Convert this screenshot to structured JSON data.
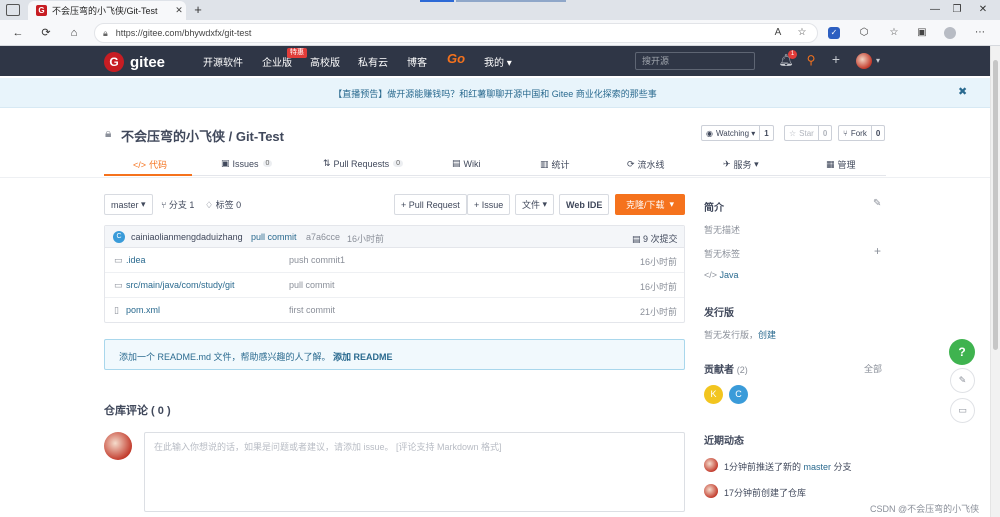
{
  "browser": {
    "tab_title": "不会压弯的小飞侠/Git-Test",
    "tab_favicon": "G",
    "url": "https://gitee.com/bhywdxfx/git-test"
  },
  "nav": {
    "brand": "gitee",
    "items": [
      "开源软件",
      "企业版",
      "高校版",
      "私有云",
      "博客",
      "Go",
      "我的"
    ],
    "enterprise_badge": "特惠",
    "search_placeholder": "搜开源",
    "notification_count": "1"
  },
  "banner": {
    "text": "【直播预告】做开源能赚钱吗？和红薯聊聊开源中国和 Gitee 商业化探索的那些事",
    "close": "✖"
  },
  "repo": {
    "title": "不会压弯的小飞侠 / Git-Test",
    "watching_label": "Watching",
    "watching_count": "1",
    "star_label": "Star",
    "star_count": "0",
    "fork_label": "Fork",
    "fork_count": "0"
  },
  "tabs": [
    {
      "label": "代码",
      "icon": "</>"
    },
    {
      "label": "Issues",
      "count": "0",
      "icon": "▣"
    },
    {
      "label": "Pull Requests",
      "count": "0",
      "icon": "⇅"
    },
    {
      "label": "Wiki",
      "icon": "▤"
    },
    {
      "label": "统计",
      "icon": "▥"
    },
    {
      "label": "流水线",
      "icon": "⟳"
    },
    {
      "label": "服务",
      "icon": "✈"
    },
    {
      "label": "管理",
      "icon": "▦"
    }
  ],
  "toolbar": {
    "branch": "master",
    "branches": "分支 1",
    "tags": "标签 0",
    "pull_request": "+ Pull Request",
    "issue": "+ Issue",
    "file": "文件",
    "web_ide": "Web IDE",
    "clone": "克隆/下载"
  },
  "latest_commit": {
    "avatar": "C",
    "author": "cainiaolianmengdaduizhang",
    "message": "pull commit",
    "hash": "a7a6cce",
    "time": "16小时前",
    "total": "9 次提交"
  },
  "files": [
    {
      "name": ".idea",
      "type": "folder",
      "commit": "push commit1",
      "time": "16小时前"
    },
    {
      "name": "src/main/java/com/study/git",
      "type": "folder",
      "commit": "pull commit",
      "time": "16小时前"
    },
    {
      "name": "pom.xml",
      "type": "file",
      "commit": "first commit",
      "time": "21小时前"
    }
  ],
  "readme": {
    "text": "添加一个 README.md 文件，帮助感兴趣的人了解。",
    "link": "添加 README"
  },
  "comments": {
    "title": "仓库评论 ( 0 )",
    "placeholder": "在此输入你想说的话，如果是问题或者建议，请添加 issue。 [评论支持 Markdown 格式]"
  },
  "sidebar": {
    "intro_title": "简介",
    "no_desc": "暂无描述",
    "no_tags": "暂无标签",
    "language": "Java",
    "release_title": "发行版",
    "no_release": "暂无发行版，",
    "create": "创建",
    "contributors_title": "贡献者",
    "contributors_count": "(2)",
    "all": "全部",
    "contributors": [
      "K",
      "C"
    ],
    "activity_title": "近期动态",
    "activities": [
      {
        "prefix": "1分钟前推送了新的 ",
        "branch": "master",
        "suffix": " 分支"
      },
      {
        "prefix": "17分钟前创建了仓库",
        "branch": "",
        "suffix": ""
      }
    ]
  },
  "floating": {
    "help": "?"
  },
  "watermark": "CSDN @不会压弯的小飞侠",
  "colors": {
    "accent": "#f5721d",
    "brand": "#c71d23",
    "nav_bg": "#2f3646",
    "link": "#2a6a8f"
  }
}
